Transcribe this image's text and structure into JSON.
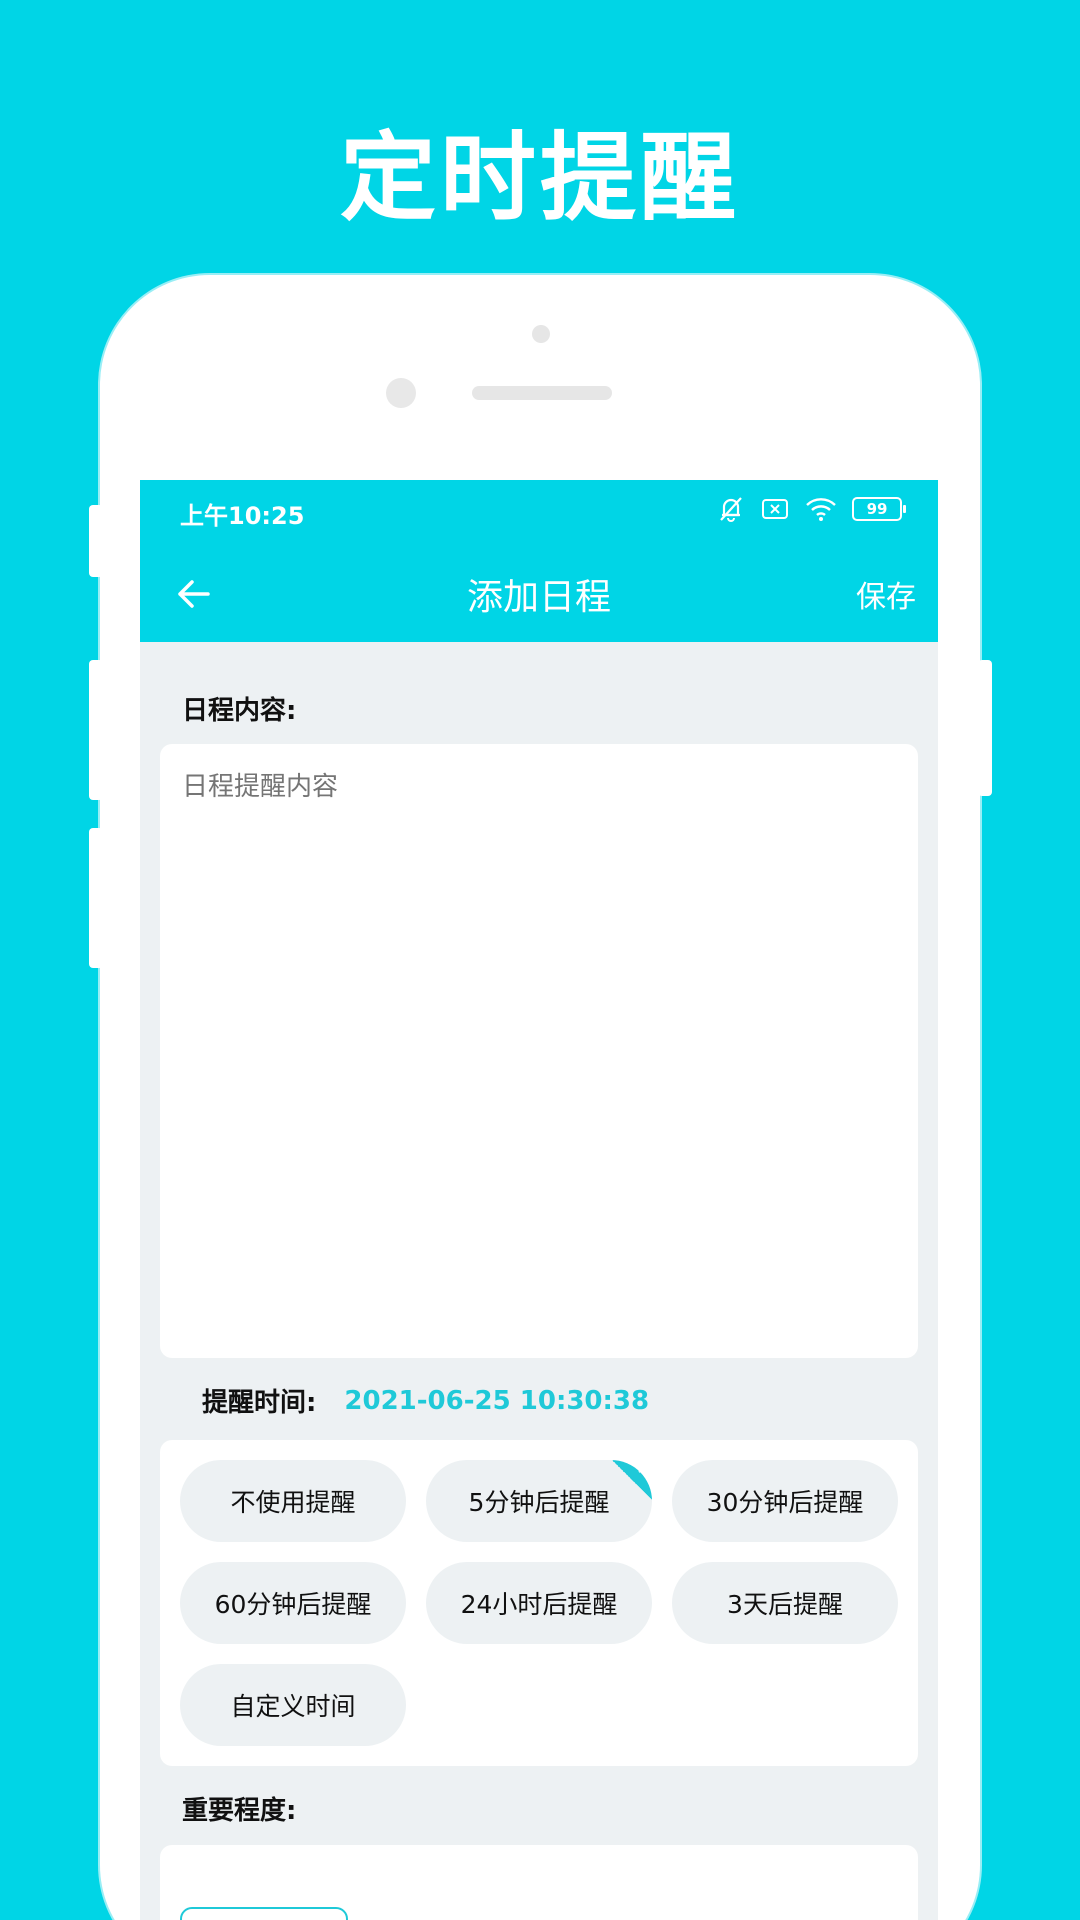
{
  "promo": {
    "title": "定时提醒"
  },
  "status_bar": {
    "time": "上午10:25",
    "battery": "99"
  },
  "nav": {
    "title": "添加日程",
    "save_label": "保存",
    "back_icon": "arrow-left-icon"
  },
  "content_section": {
    "label": "日程内容:",
    "placeholder": "日程提醒内容"
  },
  "remind": {
    "label": "提醒时间:",
    "value": "2021-06-25 10:30:38",
    "options": [
      {
        "label": "不使用提醒",
        "selected": false
      },
      {
        "label": "5分钟后提醒",
        "selected": true
      },
      {
        "label": "30分钟后提醒",
        "selected": false
      },
      {
        "label": "60分钟后提醒",
        "selected": false
      },
      {
        "label": "24小时后提醒",
        "selected": false
      },
      {
        "label": "3天后提醒",
        "selected": false
      },
      {
        "label": "自定义时间",
        "selected": false
      }
    ]
  },
  "importance": {
    "label": "重要程度:"
  },
  "colors": {
    "accent": "#00d5e6",
    "accent_text": "#1fc9d8",
    "background": "#edf1f3"
  }
}
